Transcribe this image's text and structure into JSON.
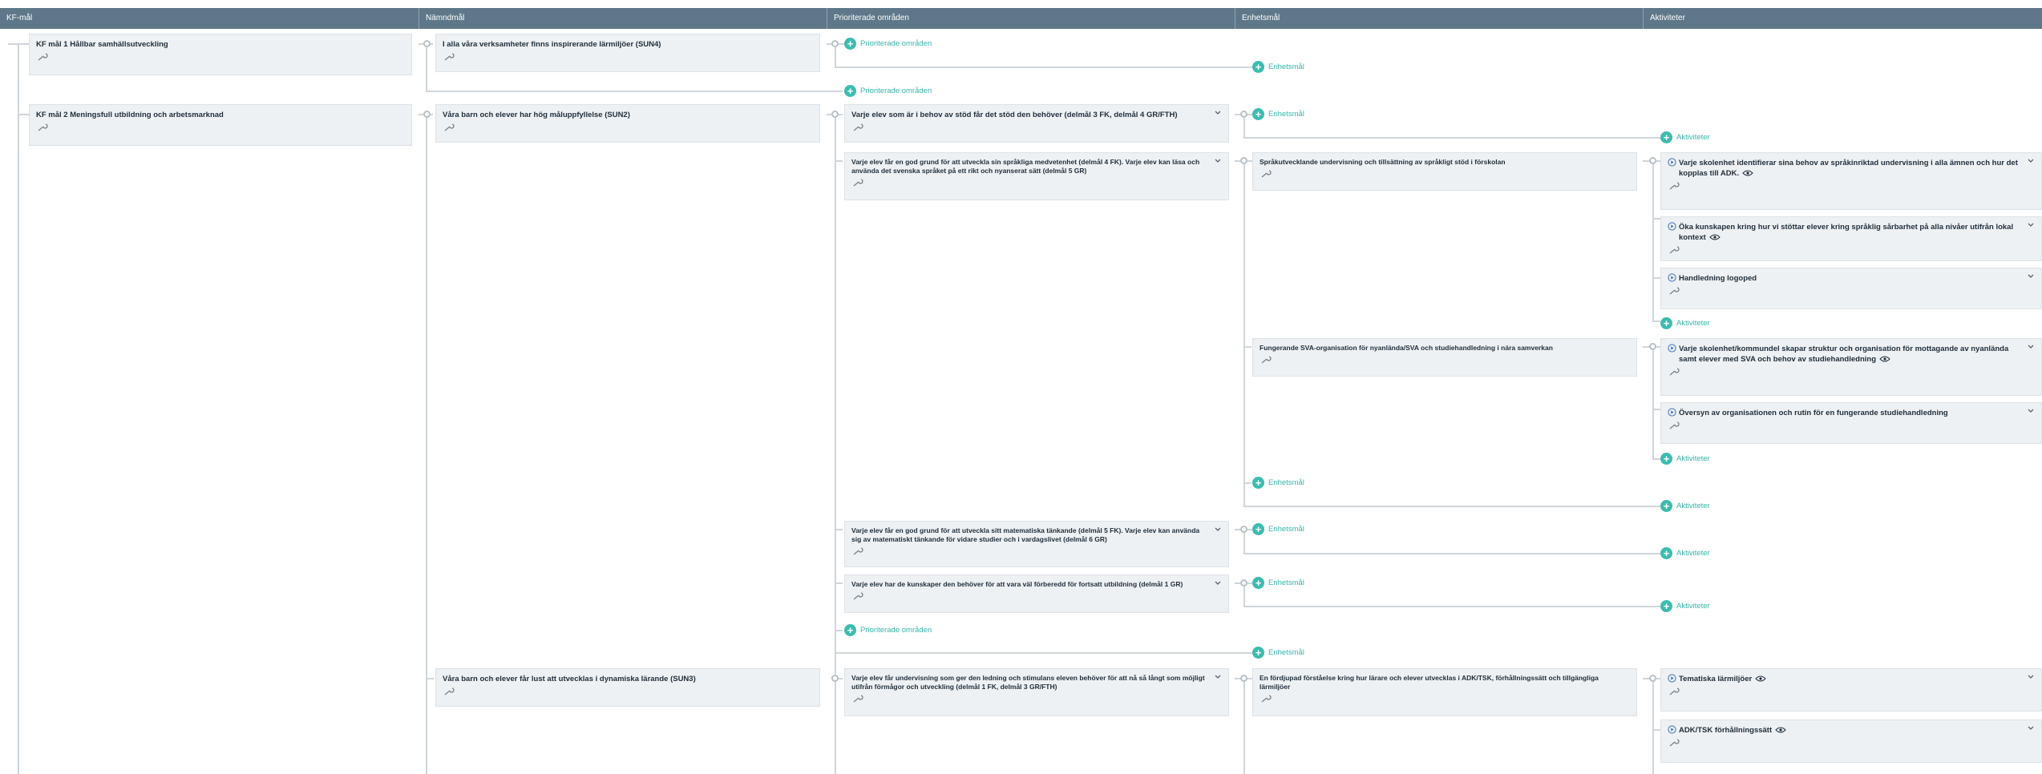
{
  "header": {
    "columns": [
      "KF-mål",
      "Nämndmål",
      "Prioriterade områden",
      "Enhetsmål",
      "Aktiviteter"
    ]
  },
  "kf_goals": [
    "KF mål 1 Hållbar samhällsutveckling",
    "KF mål 2 Meningsfull utbildning och arbetsmarknad"
  ],
  "namnd_goals": [
    "I alla våra verksamheter finns inspirerande lärmiljöer (SUN4)",
    "Våra barn och elever har hög måluppfyllelse (SUN2)",
    "Våra barn och elever får lust att utvecklas i dynamiska lärande (SUN3)"
  ],
  "prio_areas": [
    "Varje elev som är i behov av stöd får det stöd den behöver (delmål 3 FK, delmål 4 GR/FTH)",
    "Varje elev får en god grund för att utveckla sin språkliga medvetenhet (delmål 4 FK). Varje elev kan läsa och använda det svenska språket på ett rikt och nyanserat sätt (delmål 5 GR)",
    "Varje elev får en god grund för att utveckla sitt matematiska tänkande (delmål 5 FK). Varje elev kan använda sig av matematiskt tänkande för vidare studier och i vardagslivet (delmål 6 GR)",
    "Varje elev har de kunskaper den behöver för att vara väl förberedd för fortsatt utbildning (delmål 1 GR)",
    "Varje elev får undervisning som ger den ledning och stimulans eleven behöver för att nå så långt som möjligt utifrån förmågor och utveckling (delmål 1 FK, delmål 3 GR/FTH)"
  ],
  "unit_goals": [
    "Språkutvecklande undervisning och tillsättning av språkligt stöd i förskolan",
    "Fungerande SVA-organisation för nyanlända/SVA och studiehandledning i nära samverkan",
    "En fördjupad förståelse kring hur lärare och elever utvecklas i ADK/TSK, förhållningssätt och tillgängliga lärmiljöer"
  ],
  "activities": [
    "Varje skolenhet identifierar sina behov av språkinriktad undervisning i alla ämnen och hur det kopplas till ADK.",
    "Öka kunskapen kring hur vi stöttar elever kring språklig sårbarhet på alla nivåer utifrån lokal kontext",
    "Handledning logoped",
    "Varje skolenhet/kommundel skapar struktur och organisation för mottagande av nyanlända samt elever med SVA och behov av studiehandledning",
    "Översyn av organisationen och rutin för en fungerande studiehandledning",
    "Tematiska lärmiljöer",
    "ADK/TSK förhållningssätt"
  ],
  "add_labels": {
    "prio": "Prioriterade områden",
    "unit": "Enhetsmål",
    "activity": "Aktiviteter"
  },
  "colors": {
    "header": "#5e7889",
    "accent": "#3cbcb0",
    "card": "#eef1f3",
    "connector": "#cfd5da"
  },
  "icons": {
    "edit": "wrench-icon",
    "expand": "chevron-down-icon",
    "add": "plus-circle-icon",
    "activity": "play-circle-icon",
    "visible": "eye-icon"
  }
}
